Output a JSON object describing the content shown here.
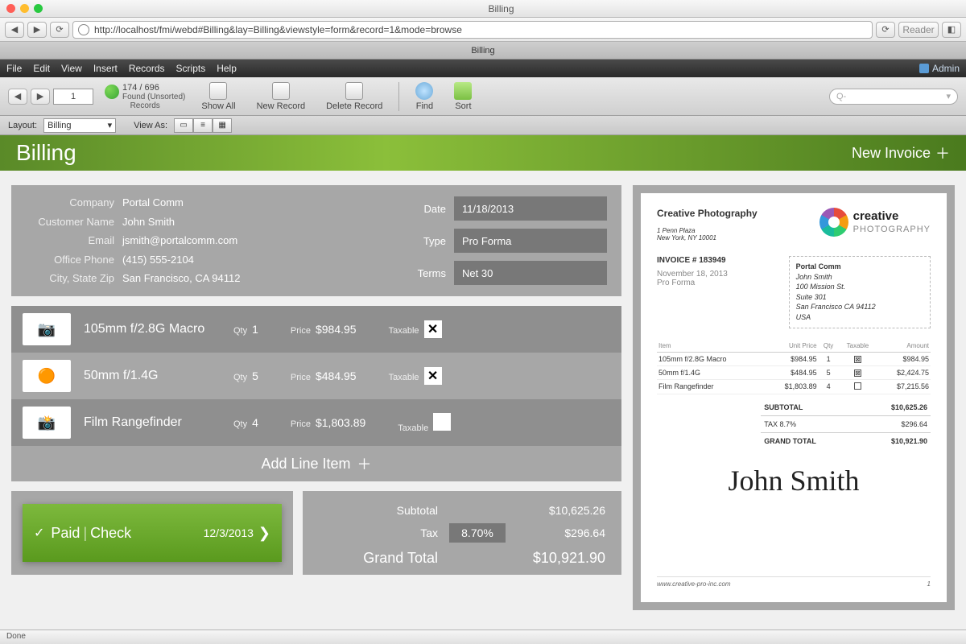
{
  "os": {
    "windowTitle": "Billing"
  },
  "browser": {
    "url": "http://localhost/fmi/webd#Billing&lay=Billing&viewstyle=form&record=1&mode=browse",
    "reader": "Reader",
    "tabTitle": "Billing"
  },
  "menubar": {
    "items": [
      "File",
      "Edit",
      "View",
      "Insert",
      "Records",
      "Scripts",
      "Help"
    ],
    "user": "Admin"
  },
  "toolbar": {
    "recordNum": "1",
    "recordCount": "174 / 696",
    "foundLabel": "Found (Unsorted)",
    "recordsLabel": "Records",
    "showAll": "Show All",
    "newRecord": "New Record",
    "deleteRecord": "Delete Record",
    "find": "Find",
    "sort": "Sort",
    "searchPrefix": "Q-"
  },
  "layoutbar": {
    "layoutLbl": "Layout:",
    "layoutName": "Billing",
    "viewAs": "View As:"
  },
  "pageHeader": {
    "title": "Billing",
    "newInvoice": "New Invoice"
  },
  "customer": {
    "labels": {
      "company": "Company",
      "name": "Customer Name",
      "email": "Email",
      "phone": "Office Phone",
      "city": "City, State Zip",
      "date": "Date",
      "type": "Type",
      "terms": "Terms"
    },
    "company": "Portal Comm",
    "name": "John Smith",
    "email": "jsmith@portalcomm.com",
    "phone": "(415) 555-2104",
    "city": "San Francisco, CA 94112",
    "date": "11/18/2013",
    "type": "Pro Forma",
    "terms": "Net 30"
  },
  "lines": {
    "qtyLbl": "Qty",
    "priceLbl": "Price",
    "taxLbl": "Taxable",
    "addLine": "Add Line Item",
    "items": [
      {
        "name": "105mm f/2.8G Macro",
        "qty": "1",
        "price": "$984.95",
        "taxable": true,
        "icon": "lens"
      },
      {
        "name": "50mm f/1.4G",
        "qty": "5",
        "price": "$484.95",
        "taxable": true,
        "icon": "filters"
      },
      {
        "name": "Film Rangefinder",
        "qty": "4",
        "price": "$1,803.89",
        "taxable": false,
        "icon": "camera"
      }
    ]
  },
  "paid": {
    "status": "Paid",
    "method": "Check",
    "date": "12/3/2013"
  },
  "totals": {
    "subtotalLbl": "Subtotal",
    "taxLbl": "Tax",
    "grandLbl": "Grand Total",
    "subtotal": "$10,625.26",
    "taxRate": "8.70%",
    "tax": "$296.64",
    "grand": "$10,921.90"
  },
  "preview": {
    "vendor": {
      "name": "Creative Photography",
      "addr1": "1 Penn Plaza",
      "addr2": "New York, NY 10001"
    },
    "logoTop": "creative",
    "logoBottom": "PHOTOGRAPHY",
    "invoiceLbl": "INVOICE # 183949",
    "date": "November 18, 2013",
    "type": "Pro Forma",
    "billTo": {
      "company": "Portal Comm",
      "name": "John Smith",
      "addr1": "100 Mission St.",
      "addr2": "Suite 301",
      "addr3": "San Francisco CA 94112",
      "addr4": "USA"
    },
    "headers": {
      "item": "Item",
      "unit": "Unit Price",
      "qty": "Qty",
      "tax": "Taxable",
      "amt": "Amount"
    },
    "rows": [
      {
        "item": "105mm f/2.8G Macro",
        "unit": "$984.95",
        "qty": "1",
        "tax": true,
        "amt": "$984.95"
      },
      {
        "item": "50mm f/1.4G",
        "unit": "$484.95",
        "qty": "5",
        "tax": true,
        "amt": "$2,424.75"
      },
      {
        "item": "Film Rangefinder",
        "unit": "$1,803.89",
        "qty": "4",
        "tax": false,
        "amt": "$7,215.56"
      }
    ],
    "subLbl": "SUBTOTAL",
    "subVal": "$10,625.26",
    "taxLbl": "TAX  8.7%",
    "taxVal": "$296.64",
    "grandLbl": "GRAND TOTAL",
    "grandVal": "$10,921.90",
    "website": "www.creative-pro-inc.com",
    "pageNum": "1"
  },
  "statusbar": {
    "done": "Done"
  }
}
